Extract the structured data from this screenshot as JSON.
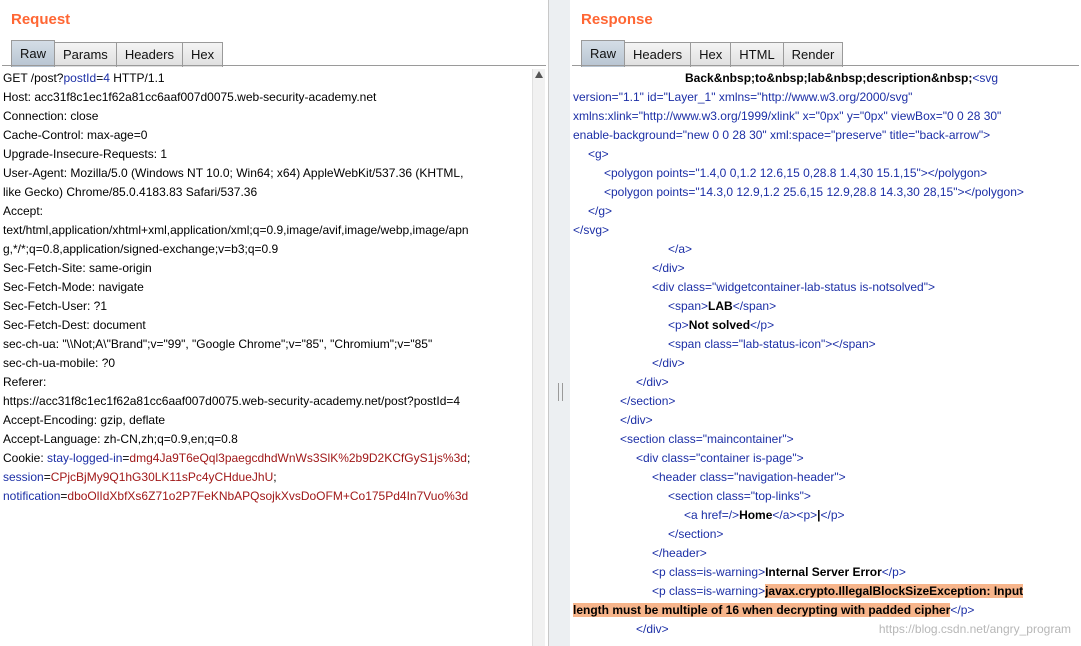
{
  "request": {
    "title": "Request",
    "tabs": [
      "Raw",
      "Params",
      "Headers",
      "Hex"
    ],
    "request_line": {
      "method_path": "GET /post?",
      "param_name": "postId",
      "param_eq": "=",
      "param_value": "4",
      "protocol": " HTTP/1.1"
    },
    "headers": [
      "Host: acc31f8c1ec1f62a81cc6aaf007d0075.web-security-academy.net",
      "Connection: close",
      "Cache-Control: max-age=0",
      "Upgrade-Insecure-Requests: 1",
      "User-Agent: Mozilla/5.0 (Windows NT 10.0; Win64; x64) AppleWebKit/537.36 (KHTML,",
      "like Gecko) Chrome/85.0.4183.83 Safari/537.36",
      "Accept:",
      "text/html,application/xhtml+xml,application/xml;q=0.9,image/avif,image/webp,image/apn",
      "g,*/*;q=0.8,application/signed-exchange;v=b3;q=0.9",
      "Sec-Fetch-Site: same-origin",
      "Sec-Fetch-Mode: navigate",
      "Sec-Fetch-User: ?1",
      "Sec-Fetch-Dest: document",
      "sec-ch-ua: \"\\\\Not;A\\\"Brand\";v=\"99\", \"Google Chrome\";v=\"85\", \"Chromium\";v=\"85\"",
      "sec-ch-ua-mobile: ?0",
      "Referer:",
      "https://acc31f8c1ec1f62a81cc6aaf007d0075.web-security-academy.net/post?postId=4",
      "Accept-Encoding: gzip, deflate",
      "Accept-Language: zh-CN,zh;q=0.9,en;q=0.8"
    ],
    "cookie": {
      "label": "Cookie: ",
      "c1_name": "stay-logged-in",
      "c1_value": "dmg4Ja9T6eQql3paegcdhdWnWs3SlK%2b9D2KCfGyS1js%3d",
      "c1_sep": ";",
      "c2_name": "session",
      "c2_value": "CPjcBjMy9Q1hG30LK11sPc4yCHdueJhU",
      "c2_sep": ";",
      "c3_name": "notification",
      "c3_value": "dboOlIdXbfXs6Z71o2P7FeKNbAPQsojkXvsDoOFM+Co175Pd4In7Vuo%3d"
    }
  },
  "response": {
    "title": "Response",
    "tabs": [
      "Raw",
      "Headers",
      "Hex",
      "HTML",
      "Render"
    ],
    "lines": {
      "l1": "Back&nbsp;to&nbsp;lab&nbsp;description&nbsp;",
      "l1_tag": "<svg",
      "l2a": "version=",
      "l2b": "\"1.1\"",
      "l2c": " id=",
      "l2d": "\"Layer_1\"",
      "l2e": " xmlns=",
      "l2f": "\"http://www.w3.org/2000/svg\"",
      "l3a": "xmlns:xlink=",
      "l3b": "\"http://www.w3.org/1999/xlink\"",
      "l3c": " x=",
      "l3d": "\"0px\"",
      "l3e": " y=",
      "l3f": "\"0px\"",
      "l3g": " viewBox=",
      "l3h": "\"0 0 28 30\"",
      "l4a": "enable-background=",
      "l4b": "\"new 0 0 28 30\"",
      "l4c": " xml:space=",
      "l4d": "\"preserve\"",
      "l4e": " title=",
      "l4f": "\"back-arrow\"",
      "l4g": ">",
      "l5": "<g>",
      "l6a": "<polygon points=",
      "l6b": "\"1.4,0 0,1.2 12.6,15 0,28.8 1.4,30 15.1,15\"",
      "l6c": "></polygon>",
      "l7a": "<polygon points=",
      "l7b": "\"14.3,0 12.9,1.2 25.6,15 12.9,28.8 14.3,30 28,15\"",
      "l7c": "></polygon>",
      "l8": "</g>",
      "l9": "</svg>",
      "l10": "</a>",
      "l11": "</div>",
      "l12a": "<div class=",
      "l12b": "\"widgetcontainer-lab-status is-notsolved\"",
      "l12c": ">",
      "l13a": "<span>",
      "l13b": "LAB",
      "l13c": "</span>",
      "l14a": "<p>",
      "l14b": "Not solved",
      "l14c": "</p>",
      "l15a": "<span class=",
      "l15b": "\"lab-status-icon\"",
      "l15c": "></span>",
      "l16": "</div>",
      "l17": "</div>",
      "l18": "</section>",
      "l19": "</div>",
      "l20a": "<section class=",
      "l20b": "\"maincontainer\"",
      "l20c": ">",
      "l21a": "<div class=",
      "l21b": "\"container is-page\"",
      "l21c": ">",
      "l22a": "<header class=",
      "l22b": "\"navigation-header\"",
      "l22c": ">",
      "l23a": "<section class=",
      "l23b": "\"top-links\"",
      "l23c": ">",
      "l24a": "<a href=",
      "l24b": "/",
      "l24c": ">",
      "l24d": "Home",
      "l24e": "</a><p>",
      "l24f": "|",
      "l24g": "</p>",
      "l25": "</section>",
      "l26": "</header>",
      "l27a": "<p class=",
      "l27b": "is-warning",
      "l27c": ">",
      "l27d": "Internal Server Error",
      "l27e": "</p>",
      "l28a": "<p class=",
      "l28b": "is-warning",
      "l28c": ">",
      "l28d": "javax.crypto.IllegalBlockSizeException: Input",
      "l29a": "length must be multiple of 16 when decrypting with padded cipher",
      "l29b": "</p>",
      "l30": "</div>"
    }
  },
  "watermark": "https://blog.csdn.net/angry_program"
}
